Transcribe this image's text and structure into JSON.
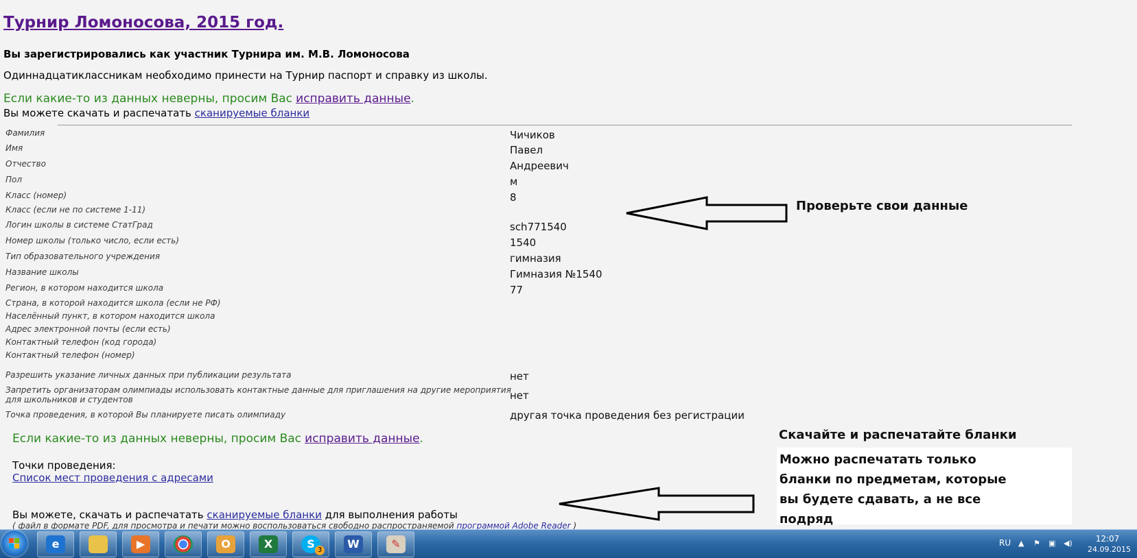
{
  "header": {
    "title": "Турнир Ломоносова, 2015 год.",
    "registered": "Вы зарегистрировались как участник Турнира им. М.В. Ломоносова",
    "notice": "Одиннадцатиклассникам необходимо принести на Турнир паспорт и справку из школы.",
    "fix_prefix": "Если какие-то из данных неверны, просим Вас",
    "fix_link": "исправить данные",
    "fix_suffix": ".",
    "download_prefix": "Вы можете скачать и распечатать",
    "download_link": "сканируемые бланки"
  },
  "fields": [
    {
      "label": "Фамилия",
      "value": "Чичиков"
    },
    {
      "label": "Имя",
      "value": "Павел"
    },
    {
      "label": "Отчество",
      "value": "Андреевич"
    },
    {
      "label": "Пол",
      "value": "м"
    },
    {
      "label": "Класс (номер)",
      "value": "8"
    },
    {
      "label": "Класс (если не по системе 1-11)",
      "value": ""
    },
    {
      "label": "Логин школы в системе СтатГрад",
      "value": "sch771540"
    },
    {
      "label": "Номер школы (только число, если есть)",
      "value": "1540"
    },
    {
      "label": "Тип образовательного учреждения",
      "value": "гимназия"
    },
    {
      "label": "Название школы",
      "value": "Гимназия №1540"
    },
    {
      "label": "Регион, в котором находится школа",
      "value": "77"
    },
    {
      "label": "Страна, в которой находится школа (если не РФ)",
      "value": ""
    },
    {
      "label": "Населённый пункт, в котором находится школа",
      "value": ""
    },
    {
      "label": "Адрес электронной почты (если есть)",
      "value": ""
    },
    {
      "label": "Контактный телефон (код города)",
      "value": ""
    },
    {
      "label": "Контактный телефон (номер)",
      "value": ""
    },
    {
      "label": "Разрешить указание личных данных при публикации результата",
      "value": "нет"
    },
    {
      "label": "Запретить организаторам олимпиады использовать контактные данные для приглашения на другие мероприятия",
      "label2": "для школьников и студентов",
      "value": "нет"
    },
    {
      "label": "Точка проведения, в которой Вы планируете писать олимпиаду",
      "value": "другая точка проведения без регистрации"
    }
  ],
  "footer": {
    "fix_prefix": "Если какие-то из данных неверны, просим Вас",
    "fix_link": "исправить данные",
    "fix_suffix": ".",
    "places_title": "Точки проведения:",
    "places_link": "Список мест проведения с адресами",
    "download_prefix": "Вы можете, скачать и распечатать",
    "download_link": "сканируемые бланки",
    "download_suffix": "для выполнения работы",
    "note_prefix": "( файл в формате PDF, для просмотра и печати можно воспользоваться свободно распространяемой",
    "note_link": "программой Adobe Reader",
    "note_suffix": ")"
  },
  "annotations": {
    "check": "Проверьте свои данные",
    "download": "Скачайте и распечатайте бланки",
    "only_1": "Можно распечатать только",
    "only_2": "бланки по предметам, которые",
    "only_3": "вы будете сдавать, а не все",
    "only_4": "подряд"
  },
  "taskbar": {
    "apps": [
      "internet-explorer",
      "file-explorer",
      "media-player",
      "chrome",
      "outlook",
      "excel",
      "skype",
      "word",
      "paint"
    ],
    "skype_badge": "3",
    "lang": "RU",
    "time": "12:07",
    "date": "24.09.2015"
  }
}
